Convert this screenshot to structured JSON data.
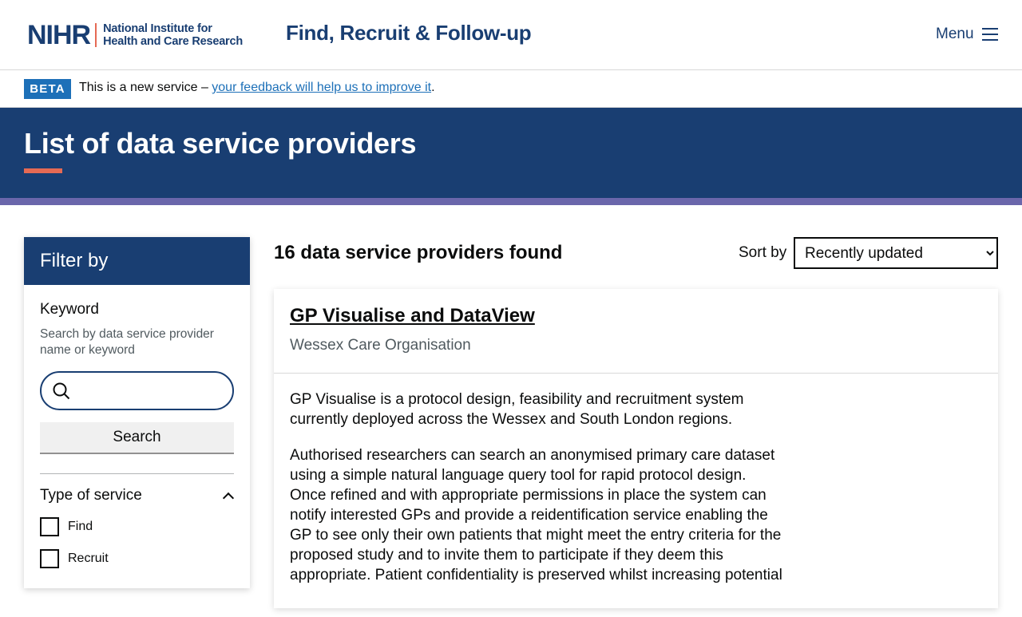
{
  "header": {
    "logo_mark": "NIHR",
    "logo_line1": "National Institute for",
    "logo_line2": "Health and Care Research",
    "service_name": "Find, Recruit & Follow-up",
    "menu_label": "Menu",
    "menu_icon": "hamburger-icon"
  },
  "beta": {
    "tag": "BETA",
    "text": "This is a new service – ",
    "link": "your feedback will help us to improve it",
    "suffix": "."
  },
  "hero": {
    "title": "List of data service providers"
  },
  "filter": {
    "heading": "Filter by",
    "keyword_label": "Keyword",
    "keyword_hint": "Search by data service provider name or keyword",
    "search_value": "",
    "search_icon": "search-icon",
    "search_button": "Search",
    "type_heading": "Type of service",
    "options": [
      {
        "label": "Find",
        "checked": false
      },
      {
        "label": "Recruit",
        "checked": false
      }
    ]
  },
  "results": {
    "count_text": "16 data service providers found",
    "sort_label": "Sort by",
    "sort_selected": "Recently updated"
  },
  "card": {
    "title": "GP Visualise and DataView",
    "organisation": "Wessex Care Organisation",
    "paragraph1": "GP Visualise is a protocol design, feasibility and recruitment system currently deployed across the Wessex and South London regions.",
    "paragraph2": "Authorised researchers can search an anonymised primary care dataset using a simple natural language query tool for rapid protocol design. Once refined and with appropriate permissions in place the system can notify interested GPs and provide a reidentification service enabling the GP to see only their own patients that might meet the entry criteria for the proposed study and to invite them to participate if they deem this appropriate. Patient confidentiality is preserved whilst increasing potential"
  },
  "colors": {
    "brand_navy": "#193e72",
    "accent_coral": "#e56a54",
    "stripe_purple": "#6a66ab",
    "link_blue": "#1d70b8"
  }
}
